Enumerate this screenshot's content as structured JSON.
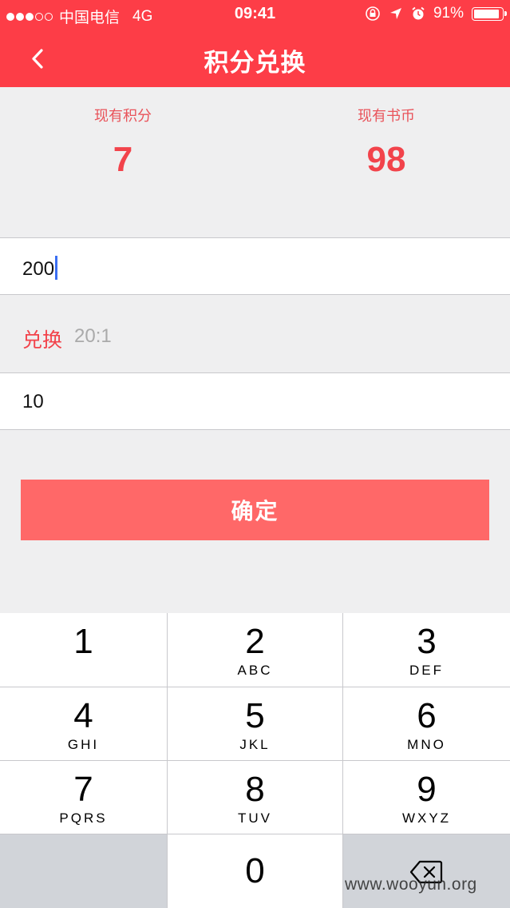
{
  "status_bar": {
    "signal_dots_filled": 3,
    "signal_dots_total": 5,
    "carrier": "中国电信",
    "network": "4G",
    "time": "09:41",
    "icons": [
      "rotation-lock-icon",
      "location-arrow-icon",
      "alarm-icon"
    ],
    "battery_percent": "91%",
    "battery_level": 0.91
  },
  "nav": {
    "title": "积分兑换",
    "back_icon": "chevron-left-icon"
  },
  "summary": {
    "points_label": "现有积分",
    "points_value": "7",
    "coins_label": "现有书币",
    "coins_value": "98"
  },
  "form": {
    "points_input_value": "200",
    "rate_label": "兑换",
    "rate_ratio": "20:1",
    "coins_output_value": "10"
  },
  "confirm_label": "确定",
  "keypad": {
    "keys": [
      {
        "digit": "1",
        "letters": ""
      },
      {
        "digit": "2",
        "letters": "ABC"
      },
      {
        "digit": "3",
        "letters": "DEF"
      },
      {
        "digit": "4",
        "letters": "GHI"
      },
      {
        "digit": "5",
        "letters": "JKL"
      },
      {
        "digit": "6",
        "letters": "MNO"
      },
      {
        "digit": "7",
        "letters": "PQRS"
      },
      {
        "digit": "8",
        "letters": "TUV"
      },
      {
        "digit": "9",
        "letters": "WXYZ"
      },
      {
        "digit": "0",
        "letters": ""
      }
    ],
    "delete_icon": "backspace-icon"
  },
  "watermark": "www.wooyun.org",
  "colors": {
    "brand_red": "#fd3d47",
    "button_red": "#ff6868",
    "accent_text": "#f2434b",
    "caret_blue": "#3b6ff2"
  }
}
